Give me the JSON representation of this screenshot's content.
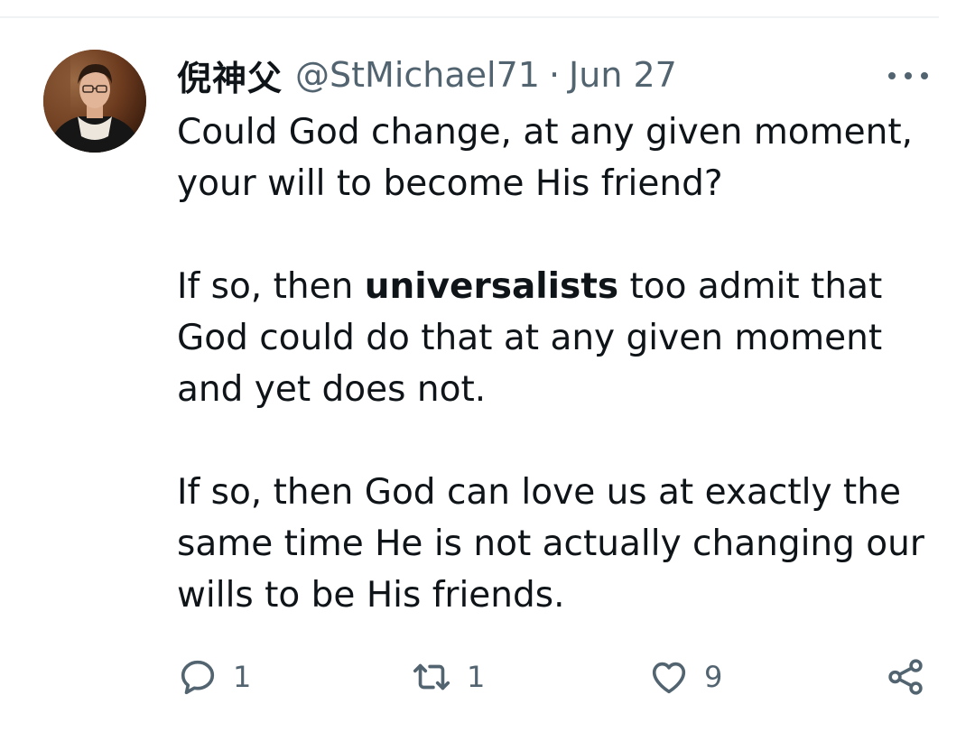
{
  "tweet": {
    "display_name": "倪神父",
    "handle": "@StMichael71",
    "separator": "·",
    "date": "Jun 27",
    "paragraphs": [
      {
        "before": "Could God change, at any given moment, your will to become His friend?",
        "bold": "",
        "after": ""
      },
      {
        "before": "If so, then ",
        "bold": "universalists",
        "after": " too admit that God could do that at any given moment and yet does not."
      },
      {
        "before": "If so, then God can love us at exactly the same time He is not actually changing our wills to be His friends.",
        "bold": "",
        "after": ""
      }
    ],
    "actions": {
      "reply_icon": "reply-icon",
      "reply_count": "1",
      "retweet_icon": "retweet-icon",
      "retweet_count": "1",
      "like_icon": "heart-icon",
      "like_count": "9",
      "share_icon": "share-icon"
    },
    "more_icon": "more-horizontal-icon"
  },
  "colors": {
    "text_primary": "#0f1419",
    "text_secondary": "#536471",
    "divider": "#eff3f4"
  }
}
